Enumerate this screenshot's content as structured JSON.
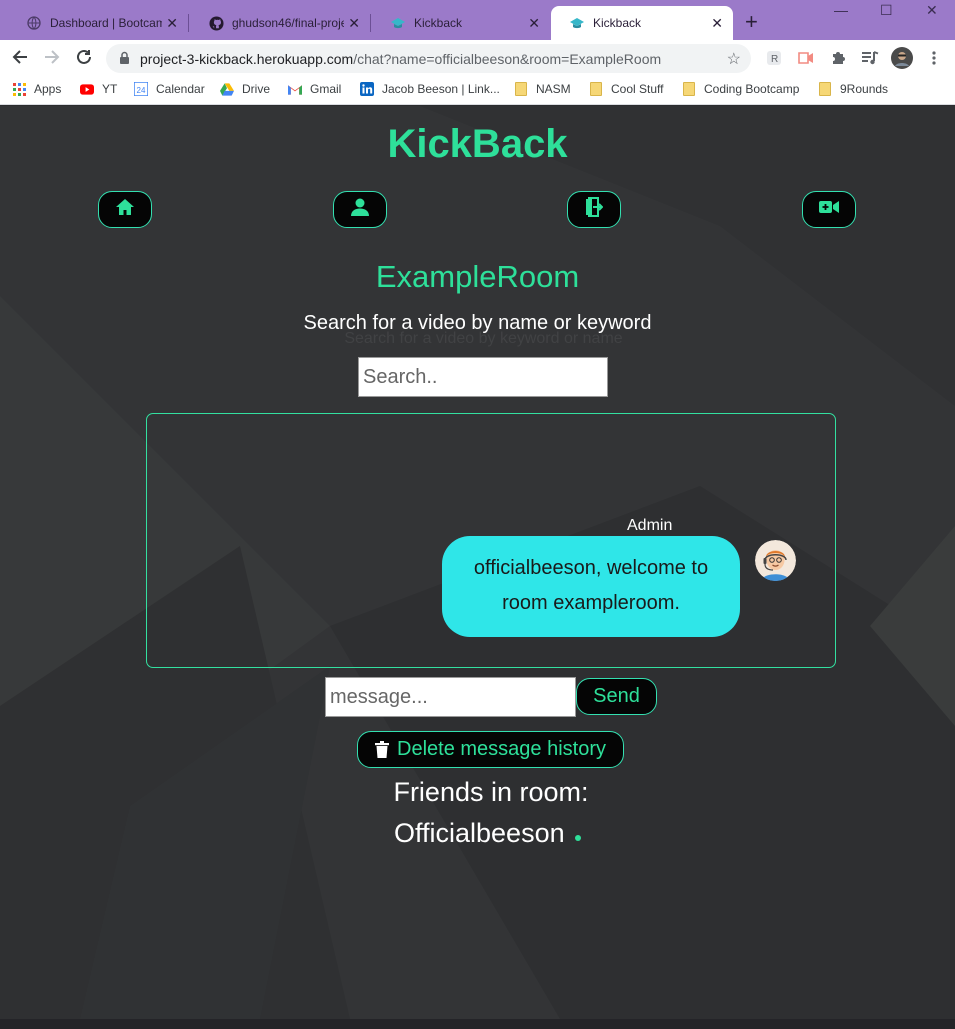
{
  "browser": {
    "tabs": [
      {
        "title": "Dashboard | Bootcamp",
        "icon": "globe-icon"
      },
      {
        "title": "ghudson46/final-proje",
        "icon": "github-icon"
      },
      {
        "title": "Kickback",
        "icon": "kickback-favicon"
      },
      {
        "title": "Kickback",
        "icon": "kickback-favicon",
        "active": true
      }
    ],
    "url_host": "project-3-kickback.herokuapp.com",
    "url_rest": "/chat?name=officialbeeson&room=ExampleRoom",
    "bookmarks": [
      {
        "label": "Apps",
        "icon": "apps-grid-icon"
      },
      {
        "label": "YT",
        "icon": "youtube-icon"
      },
      {
        "label": "Calendar",
        "icon": "calendar-icon"
      },
      {
        "label": "Drive",
        "icon": "drive-icon"
      },
      {
        "label": "Gmail",
        "icon": "gmail-icon"
      },
      {
        "label": "Jacob Beeson | Link...",
        "icon": "linkedin-icon"
      },
      {
        "label": "NASM",
        "icon": "folder-icon"
      },
      {
        "label": "Cool Stuff",
        "icon": "folder-icon"
      },
      {
        "label": "Coding Bootcamp",
        "icon": "folder-icon"
      },
      {
        "label": "9Rounds",
        "icon": "folder-icon"
      }
    ],
    "calendar_day": "24"
  },
  "app": {
    "brand": "KickBack",
    "accent": "#2ee09a",
    "nav": [
      {
        "icon": "home-icon"
      },
      {
        "icon": "user-icon"
      },
      {
        "icon": "exit-door-icon"
      },
      {
        "icon": "video-camera-icon"
      }
    ],
    "room_name": "ExampleRoom",
    "search_label": "Search for a video by name or keyword",
    "search_ghost": "Search for a video by keyword or name",
    "search_placeholder": "Search..",
    "chat": {
      "messages": [
        {
          "sender": "Admin",
          "line1": "officialbeeson, welcome to",
          "line2": "room exampleroom.",
          "bubble_color": "#2fe6e8"
        }
      ]
    },
    "message_placeholder": "message...",
    "send_label": "Send",
    "delete_label": "Delete message history",
    "friends_heading": "Friends in room:",
    "friends": [
      {
        "name": "Officialbeeson",
        "status": "online"
      }
    ]
  }
}
